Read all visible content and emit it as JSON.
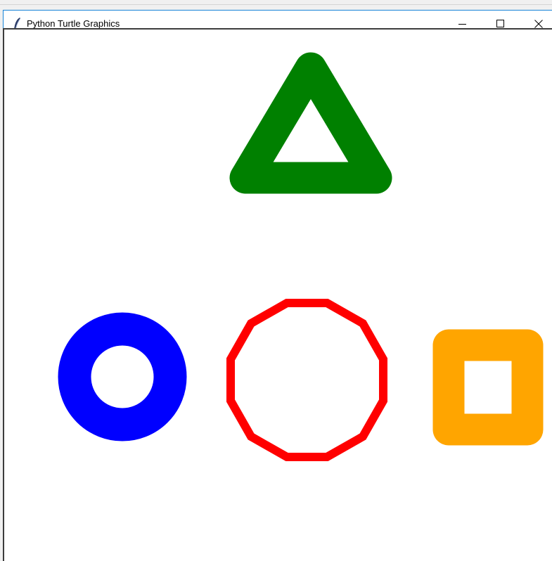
{
  "window": {
    "title": "Python Turtle Graphics",
    "icon": "tk-feather-icon",
    "controls": {
      "minimize_icon": "minimize-icon",
      "maximize_icon": "maximize-icon",
      "close_icon": "close-icon"
    }
  },
  "canvas": {
    "background": "#ffffff",
    "shapes": [
      {
        "kind": "triangle",
        "color": "#008000",
        "filled": false
      },
      {
        "kind": "circle",
        "color": "#0000ff",
        "filled": false
      },
      {
        "kind": "dodecagon",
        "color": "#ff0000",
        "filled": false
      },
      {
        "kind": "square",
        "color": "#ffa500",
        "filled": false
      }
    ]
  }
}
